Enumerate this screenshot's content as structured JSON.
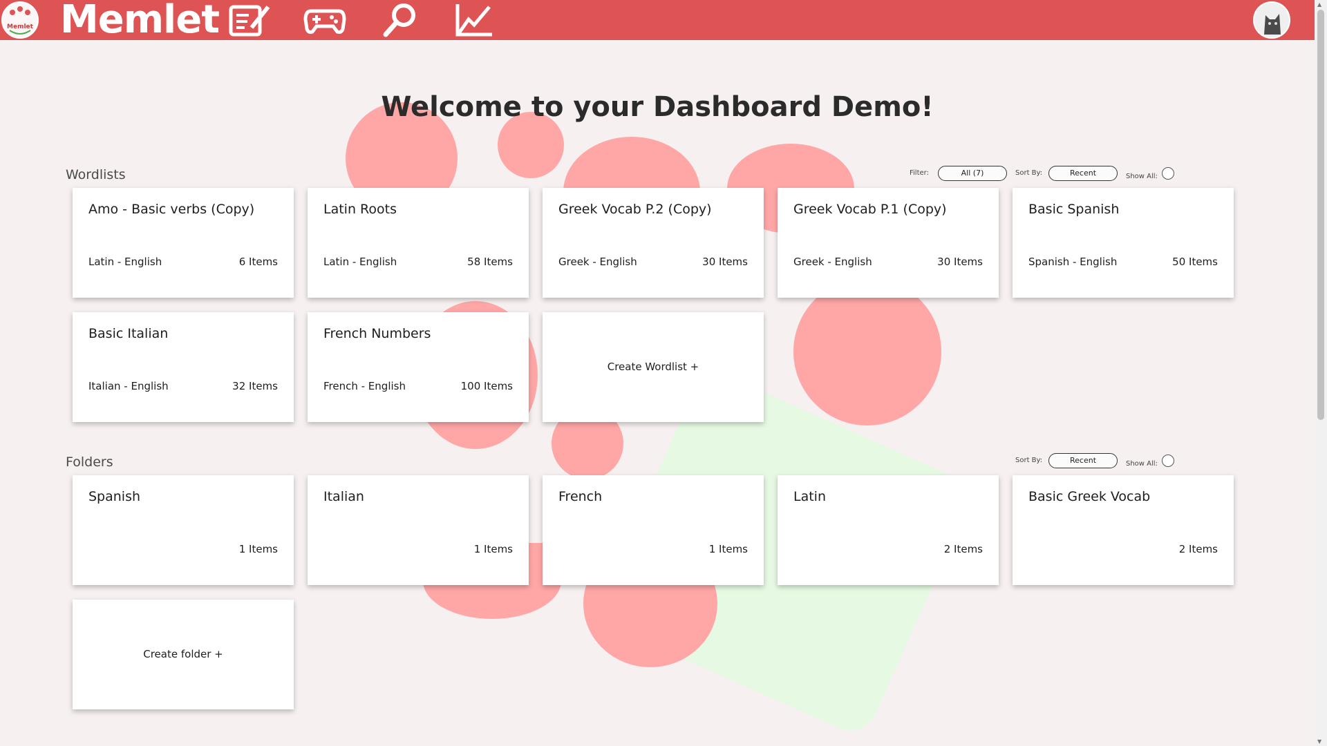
{
  "app": {
    "brand": "Memlet",
    "logo_text": "Memlet",
    "nav_icons": [
      "edit-icon",
      "gamepad-icon",
      "search-icon",
      "chart-icon"
    ]
  },
  "page": {
    "title": "Welcome to your Dashboard Demo!"
  },
  "wordlists": {
    "label": "Wordlists",
    "filter_label": "Filter:",
    "filter_value": "All (7)",
    "sort_label": "Sort By:",
    "sort_value": "Recent",
    "show_all_label": "Show All:",
    "items": [
      {
        "title": "Amo - Basic verbs (Copy)",
        "languages": "Latin - English",
        "count": "6 Items"
      },
      {
        "title": "Latin Roots",
        "languages": "Latin - English",
        "count": "58 Items"
      },
      {
        "title": "Greek Vocab P.2 (Copy)",
        "languages": "Greek - English",
        "count": "30 Items"
      },
      {
        "title": "Greek Vocab P.1 (Copy)",
        "languages": "Greek - English",
        "count": "30 Items"
      },
      {
        "title": "Basic Spanish",
        "languages": "Spanish - English",
        "count": "50 Items"
      },
      {
        "title": "Basic Italian",
        "languages": "Italian - English",
        "count": "32 Items"
      },
      {
        "title": "French Numbers",
        "languages": "French - English",
        "count": "100 Items"
      }
    ],
    "create_label": "Create Wordlist +"
  },
  "folders": {
    "label": "Folders",
    "sort_label": "Sort By:",
    "sort_value": "Recent",
    "show_all_label": "Show All:",
    "items": [
      {
        "title": "Spanish",
        "count": "1 Items"
      },
      {
        "title": "Italian",
        "count": "1 Items"
      },
      {
        "title": "French",
        "count": "1 Items"
      },
      {
        "title": "Latin",
        "count": "2 Items"
      },
      {
        "title": "Basic Greek Vocab",
        "count": "2 Items"
      }
    ],
    "create_label": "Create folder +"
  },
  "colors": {
    "navbar": "#de5353",
    "background": "#f6f0f0",
    "accent_circle": "#ffa7a7",
    "accent_green": "#e6f9e3"
  }
}
